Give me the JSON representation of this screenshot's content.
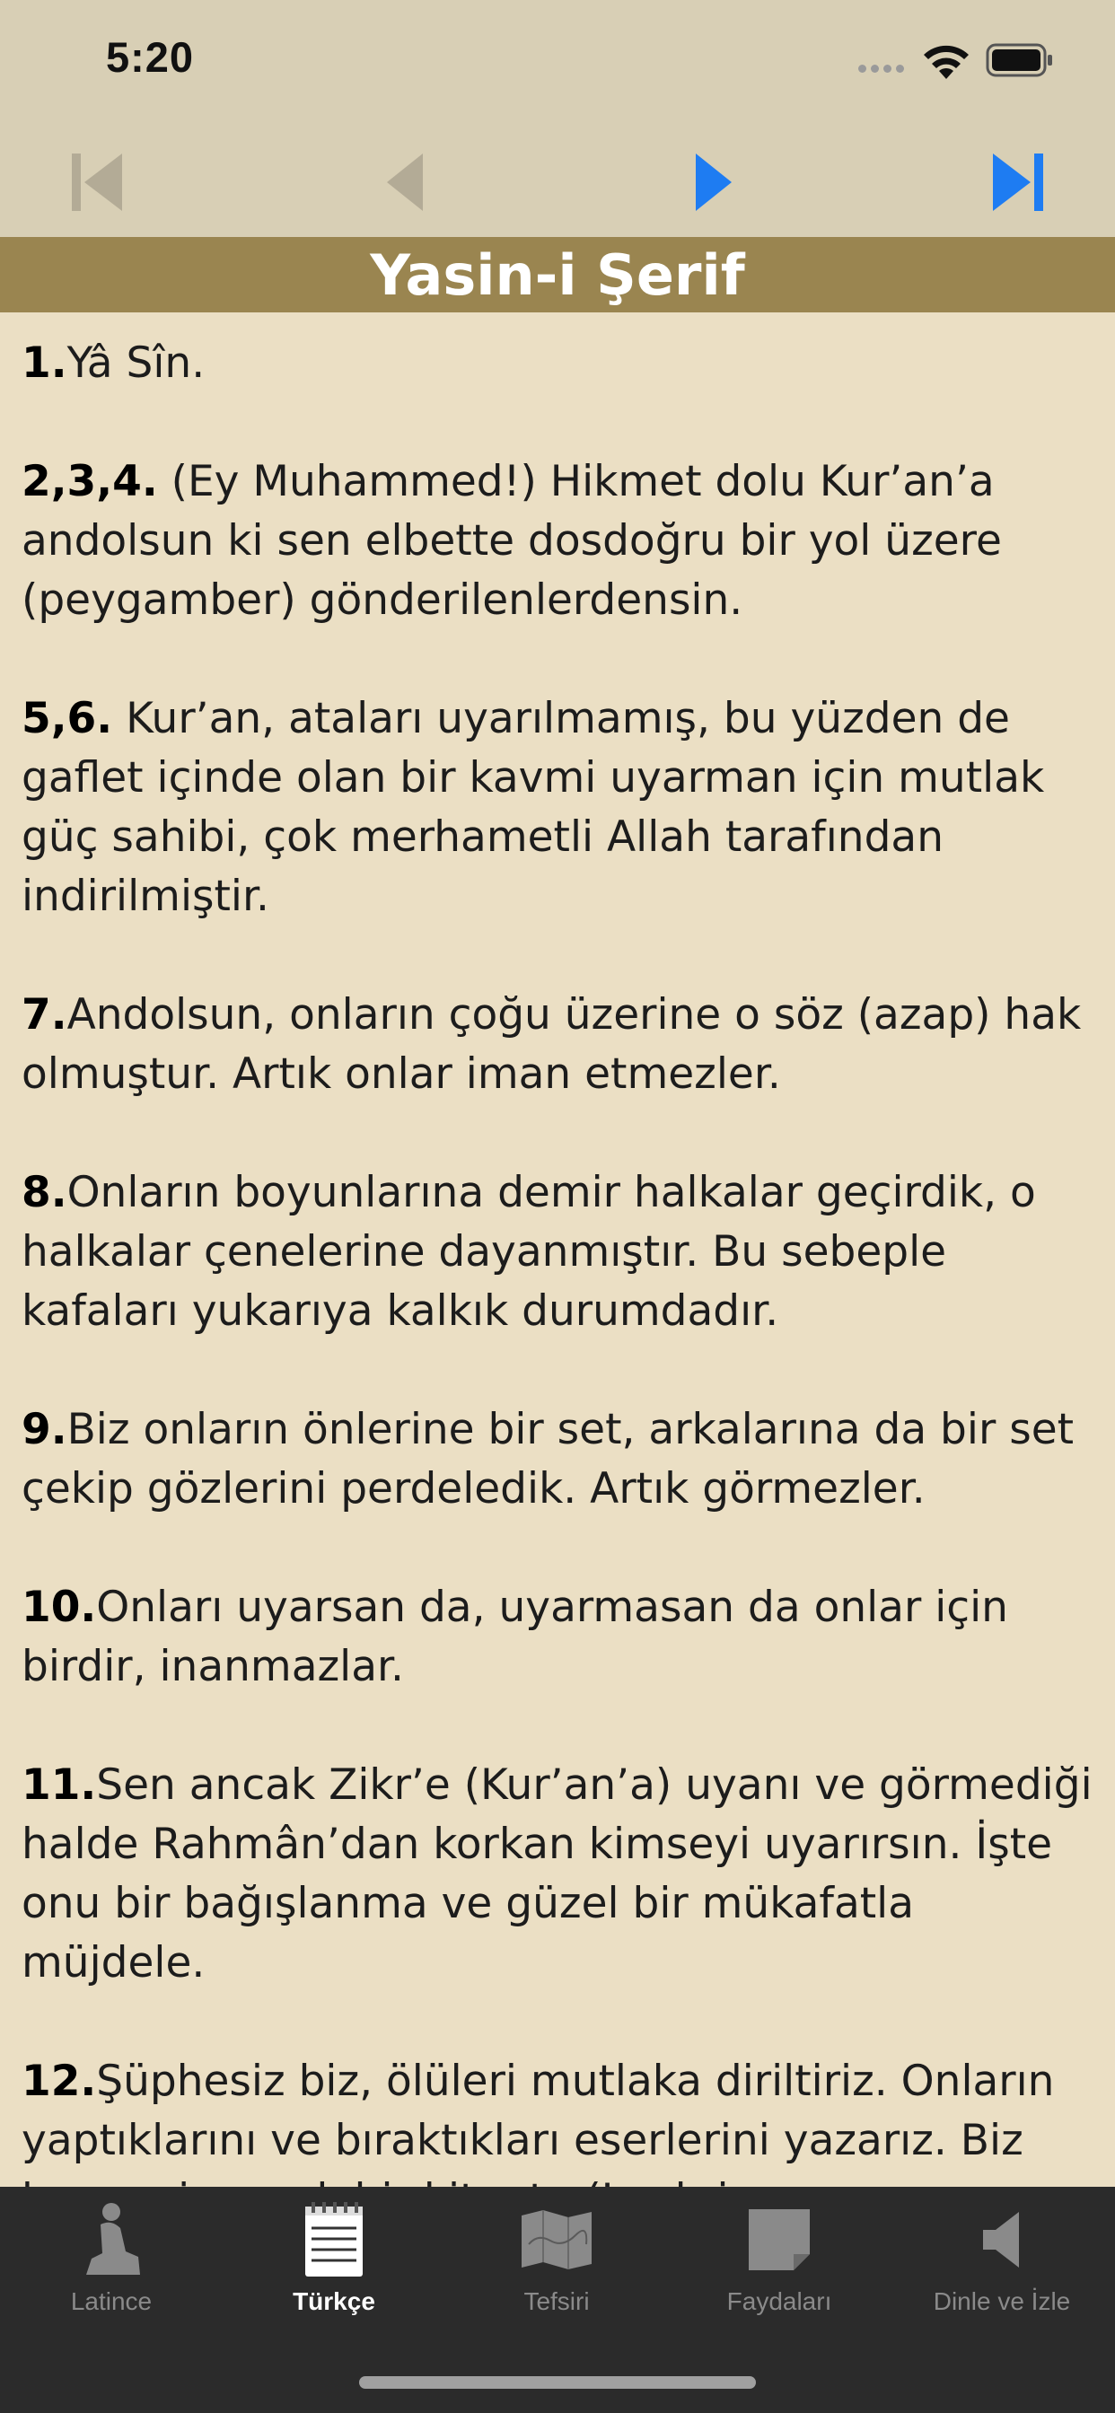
{
  "status": {
    "time": "5:20"
  },
  "title": "Yasin-i Şerif",
  "verses": [
    {
      "num": "1.",
      "text": "Yâ Sîn."
    },
    {
      "num": "2,3,4.",
      "text": " (Ey Muhammed!) Hikmet dolu Kur’an’a andolsun ki sen elbette dosdoğru bir yol üzere (peygamber) gönderilenlerdensin."
    },
    {
      "num": "5,6.",
      "text": " Kur’an, ataları uyarılmamış, bu yüzden de gaflet içinde olan bir kavmi uyarman için mutlak güç sahibi, çok merhametli Allah tarafından indirilmiştir."
    },
    {
      "num": "7.",
      "text": "Andolsun, onların çoğu üzerine o söz (azap) hak olmuştur. Artık onlar iman etmezler."
    },
    {
      "num": "8.",
      "text": "Onların boyunlarına demir halkalar geçirdik, o halkalar çenelerine dayanmıştır. Bu sebeple kafaları yukarıya kalkık durumdadır."
    },
    {
      "num": "9.",
      "text": "Biz onların önlerine bir set, arkalarına da bir set çekip gözlerini perdeledik. Artık görmezler."
    },
    {
      "num": "10.",
      "text": "Onları uyarsan da, uyarmasan da onlar için birdir, inanmazlar."
    },
    {
      "num": "11.",
      "text": "Sen ancak Zikr’e (Kur’an’a) uyanı ve görmediği halde Rahmân’dan korkan kimseyi uyarırsın. İşte onu bir bağışlanma ve güzel bir mükafatla müjdele."
    },
    {
      "num": "12.",
      "text": "Şüphesiz biz, ölüleri mutlaka diriltiriz. Onların yaptıklarını ve bıraktıkları eserlerini yazarız. Biz her şeyi apaçık bir kitapta (Levh-i"
    }
  ],
  "tabs": [
    {
      "label": "Latince",
      "icon": "prayer-icon",
      "active": false
    },
    {
      "label": "Türkçe",
      "icon": "notepad-icon",
      "active": true
    },
    {
      "label": "Tefsiri",
      "icon": "map-icon",
      "active": false
    },
    {
      "label": "Faydaları",
      "icon": "note-icon",
      "active": false
    },
    {
      "label": "Dinle ve İzle",
      "icon": "speaker-icon",
      "active": false
    }
  ],
  "colors": {
    "background": "#ebdfc4",
    "toolbar": "#d8cfb5",
    "title_bar": "#9a8550",
    "nav_active": "#1e7cf2",
    "nav_disabled": "#b3ab96",
    "tab_bar": "#2b2b2b"
  }
}
